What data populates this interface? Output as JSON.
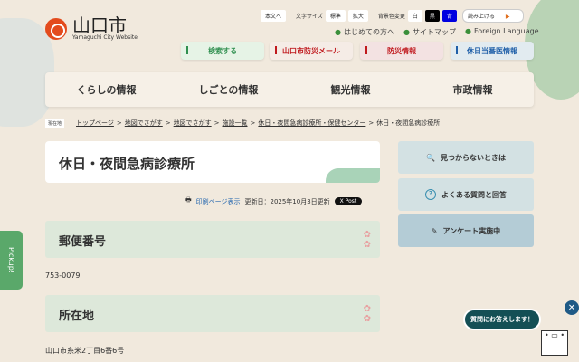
{
  "header": {
    "logo_name": "山口市",
    "logo_sub": "Yamaguchi City Website",
    "util": {
      "skip": "本文へ",
      "font_size_label": "文字サイズ",
      "font_standard": "標準",
      "font_large": "拡大",
      "bg_label": "背景色変更",
      "bg_white": "白",
      "bg_black": "黒",
      "bg_blue": "青",
      "read_aloud": "読み上げる"
    },
    "links": [
      "はじめての方へ",
      "サイトマップ",
      "Foreign Language"
    ],
    "quick": [
      {
        "label": "検索する",
        "color": "#2f8f4f"
      },
      {
        "label": "山口市防災メール",
        "color": "#c0191e"
      },
      {
        "label": "防災情報",
        "color": "#c0191e"
      },
      {
        "label": "休日当番医情報",
        "color": "#1f5fa8"
      }
    ]
  },
  "nav": [
    "くらしの情報",
    "しごとの情報",
    "観光情報",
    "市政情報"
  ],
  "breadcrumb": {
    "here": "現在地",
    "items": [
      "トップページ",
      "地図でさがす",
      "地図でさがす",
      "施設一覧",
      "休日・夜間急病診療所・保健センター"
    ],
    "current": "休日・夜間急病診療所"
  },
  "page": {
    "title": "休日・夜間急病診療所",
    "print": "印刷ページ表示",
    "updated": "更新日：2025年10月3日更新",
    "post": "X Post",
    "sections": [
      {
        "heading": "郵便番号",
        "text": "753-0079"
      },
      {
        "heading": "所在地",
        "text": "山口市糸米2丁目6番6号"
      }
    ]
  },
  "sidebar": [
    {
      "label": "見つからないときは",
      "icon": "search-doc-icon"
    },
    {
      "label": "よくある質問と回答",
      "icon": "question-icon"
    },
    {
      "label": "アンケート実施中",
      "icon": "pencil-icon"
    }
  ],
  "pickup": "Pickup!",
  "chat": {
    "bubble": "質問にお答えします！"
  }
}
